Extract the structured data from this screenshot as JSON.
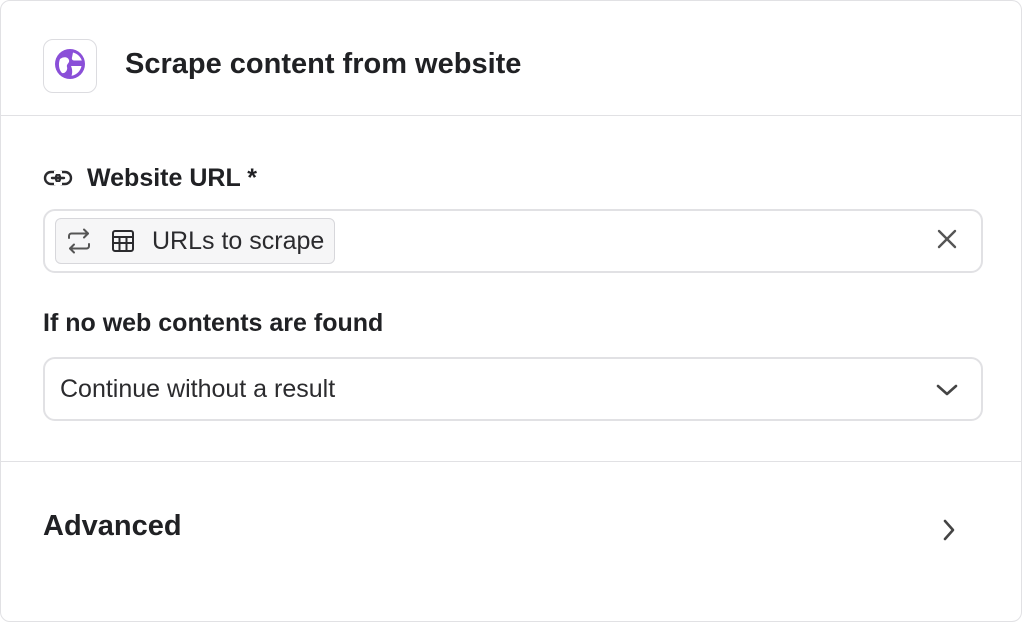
{
  "header": {
    "title": "Scrape content from website",
    "icon": "globe-icon",
    "accent_color": "#8a4fd8"
  },
  "url_field": {
    "label": "Website URL *",
    "label_icon": "link-icon",
    "chip": {
      "label": "URLs to scrape",
      "icons": [
        "loop-icon",
        "table-icon"
      ]
    },
    "clear_icon": "close-icon"
  },
  "fallback_field": {
    "label": "If no web contents are found",
    "selected_value": "Continue without a result",
    "chevron_icon": "chevron-down-icon"
  },
  "advanced": {
    "label": "Advanced",
    "chevron_icon": "chevron-right-icon"
  }
}
